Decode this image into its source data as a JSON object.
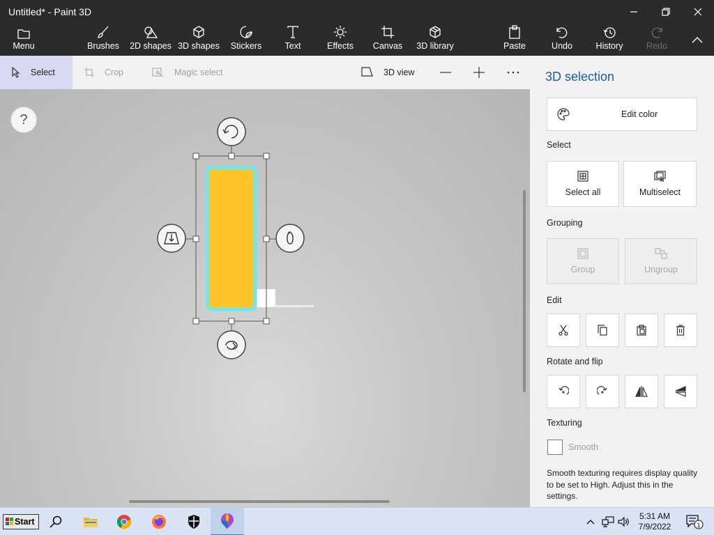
{
  "window": {
    "title": "Untitled* - Paint 3D"
  },
  "ribbon": {
    "menu": "Menu",
    "tools": [
      "Brushes",
      "2D shapes",
      "3D shapes",
      "Stickers",
      "Text",
      "Effects",
      "Canvas",
      "3D library"
    ],
    "paste": "Paste",
    "undo": "Undo",
    "history": "History",
    "redo": "Redo"
  },
  "toolbar": {
    "select": "Select",
    "crop": "Crop",
    "magic_select": "Magic select",
    "view3d": "3D view"
  },
  "canvas": {
    "help": "?",
    "shape_fill": "#ffc32a",
    "shape_outline": "#6ee8ec"
  },
  "panel": {
    "title": "3D selection",
    "edit_color": "Edit color",
    "select_label": "Select",
    "select_all": "Select all",
    "multiselect": "Multiselect",
    "grouping_label": "Grouping",
    "group": "Group",
    "ungroup": "Ungroup",
    "edit_label": "Edit",
    "rotate_label": "Rotate and flip",
    "texturing_label": "Texturing",
    "smooth": "Smooth",
    "note": "Smooth texturing requires display quality to be set to High. Adjust this in the settings."
  },
  "taskbar": {
    "start": "Start",
    "time": "5:31 AM",
    "date": "7/9/2022",
    "notifications": "1"
  },
  "colors": {
    "accent": "#1b5c9e",
    "titlebar": "#2b2b2b"
  }
}
